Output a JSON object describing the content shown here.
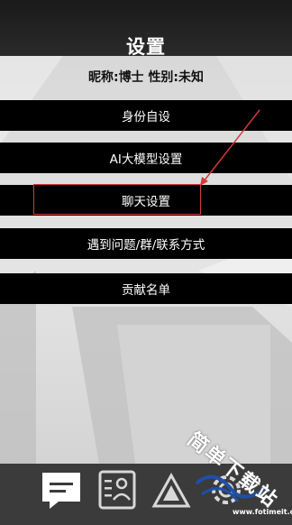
{
  "header": {
    "title": "设置"
  },
  "profile": {
    "nickname_label": "昵称:",
    "nickname_value": "博士",
    "gender_label": "性别:",
    "gender_value": "未知"
  },
  "menu": {
    "items": [
      {
        "label": "身份自设"
      },
      {
        "label": "AI大模型设置"
      },
      {
        "label": "聊天设置"
      },
      {
        "label": "遇到问题/群/联系方式"
      },
      {
        "label": "贡献名单"
      }
    ]
  },
  "annotation": {
    "highlight_color": "#d33a3a"
  },
  "bottom_nav": {
    "icons": [
      "chat-icon",
      "contact-card-icon",
      "triangle-logo-icon",
      "settings-gear-icon"
    ]
  },
  "watermark": {
    "text": "简单下载站",
    "url": "www.fotimeit.com"
  }
}
